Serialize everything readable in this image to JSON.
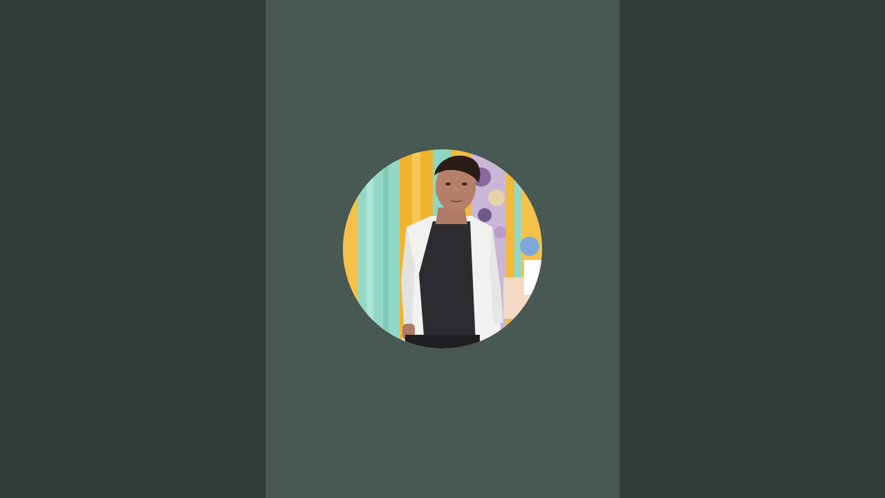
{
  "colors": {
    "side_panel": "#333e3a",
    "center_panel": "#485852",
    "backdrop_yellow": "#f2b93a",
    "backdrop_teal": "#8fd6c4",
    "shirt_white": "#f1f1ef",
    "tshirt_black": "#2c2c30",
    "hair": "#2a1c16",
    "skin": "#b5806a"
  },
  "avatar": {
    "description_icon": "profile-photo"
  }
}
